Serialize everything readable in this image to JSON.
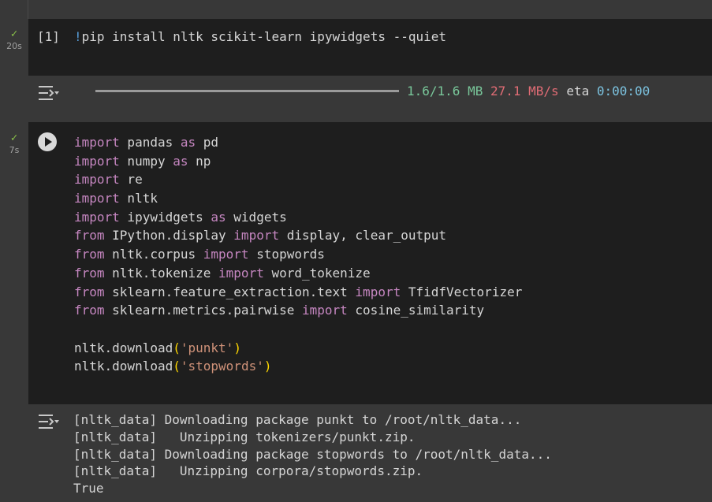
{
  "cell1": {
    "exec_count": "[1]",
    "duration": "20s",
    "bang": "!",
    "command": "pip install nltk scikit-learn ipywidgets --quiet",
    "progress": {
      "fraction": 1.0,
      "size": "1.6/1.6 MB",
      "speed": "27.1 MB/s",
      "eta_label": "eta",
      "eta": "0:00:00"
    }
  },
  "cell2": {
    "duration": "7s",
    "code": [
      [
        {
          "t": "import",
          "c": "kw"
        },
        {
          "t": " pandas ",
          "c": "id"
        },
        {
          "t": "as",
          "c": "kw"
        },
        {
          "t": " pd",
          "c": "id"
        }
      ],
      [
        {
          "t": "import",
          "c": "kw"
        },
        {
          "t": " numpy ",
          "c": "id"
        },
        {
          "t": "as",
          "c": "kw"
        },
        {
          "t": " np",
          "c": "id"
        }
      ],
      [
        {
          "t": "import",
          "c": "kw"
        },
        {
          "t": " re",
          "c": "id"
        }
      ],
      [
        {
          "t": "import",
          "c": "kw"
        },
        {
          "t": " nltk",
          "c": "id"
        }
      ],
      [
        {
          "t": "import",
          "c": "kw"
        },
        {
          "t": " ipywidgets ",
          "c": "id"
        },
        {
          "t": "as",
          "c": "kw"
        },
        {
          "t": " widgets",
          "c": "id"
        }
      ],
      [
        {
          "t": "from",
          "c": "kw"
        },
        {
          "t": " IPython.display ",
          "c": "id"
        },
        {
          "t": "import",
          "c": "kw"
        },
        {
          "t": " display, clear_output",
          "c": "id"
        }
      ],
      [
        {
          "t": "from",
          "c": "kw"
        },
        {
          "t": " nltk.corpus ",
          "c": "id"
        },
        {
          "t": "import",
          "c": "kw"
        },
        {
          "t": " stopwords",
          "c": "id"
        }
      ],
      [
        {
          "t": "from",
          "c": "kw"
        },
        {
          "t": " nltk.tokenize ",
          "c": "id"
        },
        {
          "t": "import",
          "c": "kw"
        },
        {
          "t": " word_tokenize",
          "c": "id"
        }
      ],
      [
        {
          "t": "from",
          "c": "kw"
        },
        {
          "t": " sklearn.feature_extraction.text ",
          "c": "id"
        },
        {
          "t": "import",
          "c": "kw"
        },
        {
          "t": " TfidfVectorizer",
          "c": "id"
        }
      ],
      [
        {
          "t": "from",
          "c": "kw"
        },
        {
          "t": " sklearn.metrics.pairwise ",
          "c": "id"
        },
        {
          "t": "import",
          "c": "kw"
        },
        {
          "t": " cosine_similarity",
          "c": "id"
        }
      ],
      [],
      [
        {
          "t": "nltk.download",
          "c": "id"
        },
        {
          "t": "(",
          "c": "paren"
        },
        {
          "t": "'punkt'",
          "c": "str"
        },
        {
          "t": ")",
          "c": "paren"
        }
      ],
      [
        {
          "t": "nltk.download",
          "c": "id"
        },
        {
          "t": "(",
          "c": "paren"
        },
        {
          "t": "'stopwords'",
          "c": "str"
        },
        {
          "t": ")",
          "c": "paren"
        }
      ]
    ],
    "output": [
      "[nltk_data] Downloading package punkt to /root/nltk_data...",
      "[nltk_data]   Unzipping tokenizers/punkt.zip.",
      "[nltk_data] Downloading package stopwords to /root/nltk_data...",
      "[nltk_data]   Unzipping corpora/stopwords.zip.",
      "True"
    ]
  },
  "icons": {
    "status": "check-icon",
    "output_toggle": "output-collapse-icon",
    "run": "play-icon"
  }
}
